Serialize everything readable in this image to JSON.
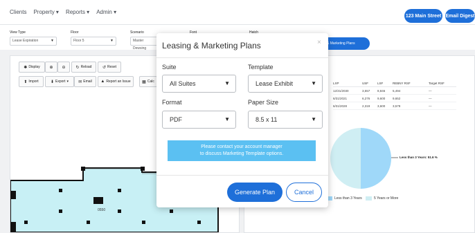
{
  "nav": {
    "items": [
      "Clients",
      "Property",
      "Reports",
      "Admin"
    ],
    "buttons": [
      "123 Main Street",
      "Email Digest"
    ]
  },
  "filters": [
    {
      "label": "View Type",
      "value": "Lease Expiration"
    },
    {
      "label": "Floor",
      "value": "Floor 5"
    },
    {
      "label": "Scenario",
      "value": "Master Dewsing"
    },
    {
      "label": "Font",
      "value": ""
    },
    {
      "label": "Hatch",
      "value": ""
    }
  ],
  "lm_button": "& Marketing Plans",
  "toolbar": {
    "row1": [
      "Display",
      "Reload",
      "Reset"
    ],
    "row2": [
      "Import",
      "Export",
      "Email",
      "Report an Issue",
      "Calc"
    ]
  },
  "floor_plan": {
    "label": "0550"
  },
  "table": {
    "headers": [
      "LXP",
      "USF",
      "LSF",
      "REBNY RSF",
      "Target RSF"
    ],
    "rows": [
      [
        "12/31/2030",
        "3,557",
        "8,846",
        "5,494",
        "—"
      ],
      [
        "6/31/2021",
        "6,276",
        "9,600",
        "9,652",
        "—"
      ],
      [
        "6/31/2028",
        "2,319",
        "3,600",
        "3,579",
        "—"
      ]
    ]
  },
  "chart": {
    "slice_label": "Less than 3 Years: 51.6 %",
    "legend": [
      "Less than 3 Years",
      "5 Years or More"
    ],
    "colors": [
      "#9fd8f9",
      "#cfeef3"
    ]
  },
  "modal": {
    "title": "Leasing & Marketing Plans",
    "close": "×",
    "suite_label": "Suite",
    "suite_value": "All Suites",
    "template_label": "Template",
    "template_value": "Lease Exhibit",
    "format_label": "Format",
    "format_value": "PDF",
    "paper_label": "Paper Size",
    "paper_value": "8.5 x 11",
    "note_line1": "Please contact your account manager",
    "note_line2": "to discuss Marketing Template options.",
    "generate": "Generate Plan",
    "cancel": "Cancel"
  }
}
